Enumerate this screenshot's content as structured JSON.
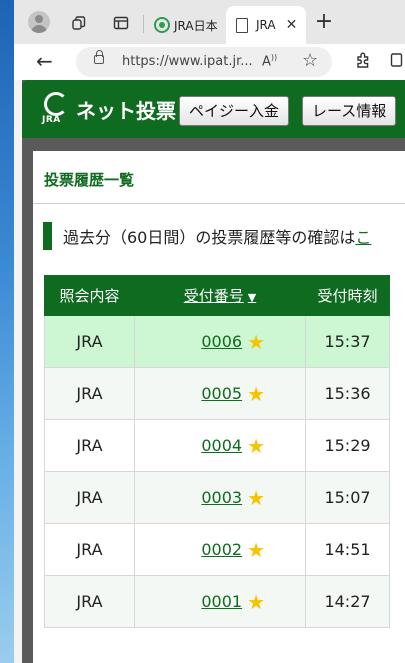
{
  "browser": {
    "tabs": [
      {
        "title": "JRA日本"
      },
      {
        "title": "JRA"
      }
    ],
    "url": "https://www.ipat.jr..."
  },
  "header": {
    "logo_text": "ネット投票",
    "logo_mark": "JRA",
    "buttons": [
      {
        "label": "ペイジー入金"
      },
      {
        "label": "レース情報"
      }
    ]
  },
  "main": {
    "title": "投票履歴一覧",
    "notice_text": "過去分（60日間）の投票履歴等の確認は",
    "notice_link": "こ",
    "table": {
      "headers": [
        "照会内容",
        "受付番号",
        "受付時刻"
      ],
      "sort_indicator": "▼",
      "rows": [
        {
          "content": "JRA",
          "number": "0006",
          "time": "15:37"
        },
        {
          "content": "JRA",
          "number": "0005",
          "time": "15:36"
        },
        {
          "content": "JRA",
          "number": "0004",
          "time": "15:29"
        },
        {
          "content": "JRA",
          "number": "0003",
          "time": "15:07"
        },
        {
          "content": "JRA",
          "number": "0002",
          "time": "14:51"
        },
        {
          "content": "JRA",
          "number": "0001",
          "time": "14:27"
        }
      ]
    }
  },
  "colors": {
    "brand_green": "#0f6b1f",
    "highlight_row": "#cdf7d3",
    "star": "#f5c400"
  }
}
